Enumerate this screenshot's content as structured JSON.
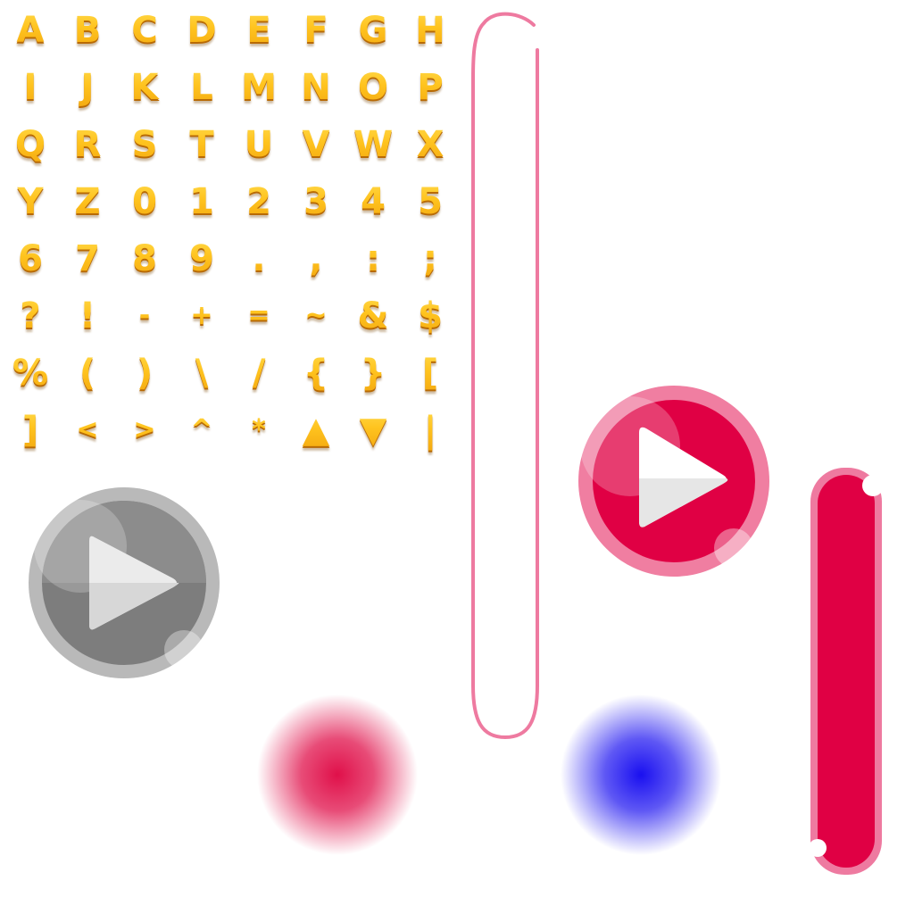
{
  "glyphs": [
    "A",
    "B",
    "C",
    "D",
    "E",
    "F",
    "G",
    "H",
    "I",
    "J",
    "K",
    "L",
    "M",
    "N",
    "O",
    "P",
    "Q",
    "R",
    "S",
    "T",
    "U",
    "V",
    "W",
    "X",
    "Y",
    "Z",
    "0",
    "1",
    "2",
    "3",
    "4",
    "5",
    "6",
    "7",
    "8",
    "9",
    ".",
    ",",
    ":",
    ";",
    "?",
    "!",
    "-",
    "+",
    "=",
    "~",
    "&",
    "$",
    "%",
    "(",
    ")",
    "\\",
    "/",
    "{",
    "}",
    "[",
    "]",
    "<",
    ">",
    "^",
    "*",
    "▲",
    "▼",
    "|"
  ],
  "colors": {
    "glyph_gold": "#f6b512",
    "pink_outline": "#ee7aa0",
    "crimson": "#e00044",
    "pink_ring": "#f0789c",
    "gray_ring": "#b3b3b3",
    "gray_fill": "#7a7a7a",
    "red_orb": "#e0104a",
    "blue_orb": "#1a10f0"
  },
  "icons": {
    "play_gray": "play-icon",
    "play_pink": "play-icon"
  }
}
